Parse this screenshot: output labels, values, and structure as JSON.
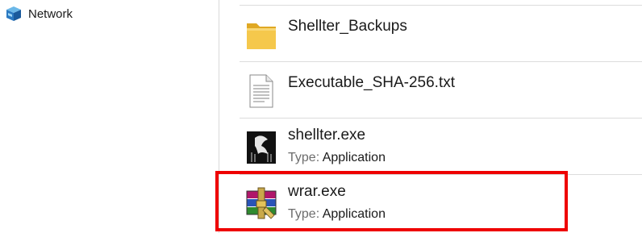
{
  "navigation": {
    "network_label": "Network",
    "network_icon": "network-icon"
  },
  "files": [
    {
      "name": "Shellter_Backups",
      "icon": "folder-icon"
    },
    {
      "name": "Executable_SHA-256.txt",
      "icon": "text-file-icon"
    },
    {
      "name": "shellter.exe",
      "type_label": "Type:",
      "type_value": "Application",
      "icon": "shellter-app-icon"
    },
    {
      "name": "wrar.exe",
      "type_label": "Type:",
      "type_value": "Application",
      "icon": "winrar-app-icon"
    }
  ],
  "colors": {
    "highlight": "#ee0000",
    "folder": "#f5c84c"
  }
}
